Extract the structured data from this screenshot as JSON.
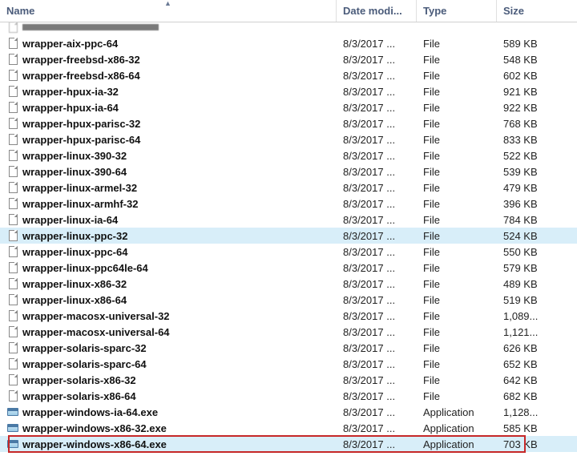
{
  "columns": {
    "name": "Name",
    "date": "Date modi...",
    "type": "Type",
    "size": "Size"
  },
  "cut_top": {
    "date": "",
    "type": "",
    "size": ""
  },
  "rows": [
    {
      "icon": "file",
      "name": "wrapper-aix-ppc-64",
      "date": "8/3/2017 ...",
      "type": "File",
      "size": "589 KB",
      "sel": false,
      "hl": false
    },
    {
      "icon": "file",
      "name": "wrapper-freebsd-x86-32",
      "date": "8/3/2017 ...",
      "type": "File",
      "size": "548 KB",
      "sel": false,
      "hl": false
    },
    {
      "icon": "file",
      "name": "wrapper-freebsd-x86-64",
      "date": "8/3/2017 ...",
      "type": "File",
      "size": "602 KB",
      "sel": false,
      "hl": false
    },
    {
      "icon": "file",
      "name": "wrapper-hpux-ia-32",
      "date": "8/3/2017 ...",
      "type": "File",
      "size": "921 KB",
      "sel": false,
      "hl": false
    },
    {
      "icon": "file",
      "name": "wrapper-hpux-ia-64",
      "date": "8/3/2017 ...",
      "type": "File",
      "size": "922 KB",
      "sel": false,
      "hl": false
    },
    {
      "icon": "file",
      "name": "wrapper-hpux-parisc-32",
      "date": "8/3/2017 ...",
      "type": "File",
      "size": "768 KB",
      "sel": false,
      "hl": false
    },
    {
      "icon": "file",
      "name": "wrapper-hpux-parisc-64",
      "date": "8/3/2017 ...",
      "type": "File",
      "size": "833 KB",
      "sel": false,
      "hl": false
    },
    {
      "icon": "file",
      "name": "wrapper-linux-390-32",
      "date": "8/3/2017 ...",
      "type": "File",
      "size": "522 KB",
      "sel": false,
      "hl": false
    },
    {
      "icon": "file",
      "name": "wrapper-linux-390-64",
      "date": "8/3/2017 ...",
      "type": "File",
      "size": "539 KB",
      "sel": false,
      "hl": false
    },
    {
      "icon": "file",
      "name": "wrapper-linux-armel-32",
      "date": "8/3/2017 ...",
      "type": "File",
      "size": "479 KB",
      "sel": false,
      "hl": false
    },
    {
      "icon": "file",
      "name": "wrapper-linux-armhf-32",
      "date": "8/3/2017 ...",
      "type": "File",
      "size": "396 KB",
      "sel": false,
      "hl": false
    },
    {
      "icon": "file",
      "name": "wrapper-linux-ia-64",
      "date": "8/3/2017 ...",
      "type": "File",
      "size": "784 KB",
      "sel": false,
      "hl": false
    },
    {
      "icon": "file",
      "name": "wrapper-linux-ppc-32",
      "date": "8/3/2017 ...",
      "type": "File",
      "size": "524 KB",
      "sel": true,
      "hl": false
    },
    {
      "icon": "file",
      "name": "wrapper-linux-ppc-64",
      "date": "8/3/2017 ...",
      "type": "File",
      "size": "550 KB",
      "sel": false,
      "hl": false
    },
    {
      "icon": "file",
      "name": "wrapper-linux-ppc64le-64",
      "date": "8/3/2017 ...",
      "type": "File",
      "size": "579 KB",
      "sel": false,
      "hl": false
    },
    {
      "icon": "file",
      "name": "wrapper-linux-x86-32",
      "date": "8/3/2017 ...",
      "type": "File",
      "size": "489 KB",
      "sel": false,
      "hl": false
    },
    {
      "icon": "file",
      "name": "wrapper-linux-x86-64",
      "date": "8/3/2017 ...",
      "type": "File",
      "size": "519 KB",
      "sel": false,
      "hl": false
    },
    {
      "icon": "file",
      "name": "wrapper-macosx-universal-32",
      "date": "8/3/2017 ...",
      "type": "File",
      "size": "1,089...",
      "sel": false,
      "hl": false
    },
    {
      "icon": "file",
      "name": "wrapper-macosx-universal-64",
      "date": "8/3/2017 ...",
      "type": "File",
      "size": "1,121...",
      "sel": false,
      "hl": false
    },
    {
      "icon": "file",
      "name": "wrapper-solaris-sparc-32",
      "date": "8/3/2017 ...",
      "type": "File",
      "size": "626 KB",
      "sel": false,
      "hl": false
    },
    {
      "icon": "file",
      "name": "wrapper-solaris-sparc-64",
      "date": "8/3/2017 ...",
      "type": "File",
      "size": "652 KB",
      "sel": false,
      "hl": false
    },
    {
      "icon": "file",
      "name": "wrapper-solaris-x86-32",
      "date": "8/3/2017 ...",
      "type": "File",
      "size": "642 KB",
      "sel": false,
      "hl": false
    },
    {
      "icon": "file",
      "name": "wrapper-solaris-x86-64",
      "date": "8/3/2017 ...",
      "type": "File",
      "size": "682 KB",
      "sel": false,
      "hl": false
    },
    {
      "icon": "exe",
      "name": "wrapper-windows-ia-64.exe",
      "date": "8/3/2017 ...",
      "type": "Application",
      "size": "1,128...",
      "sel": false,
      "hl": false
    },
    {
      "icon": "exe",
      "name": "wrapper-windows-x86-32.exe",
      "date": "8/3/2017 ...",
      "type": "Application",
      "size": "585 KB",
      "sel": false,
      "hl": false
    },
    {
      "icon": "exe",
      "name": "wrapper-windows-x86-64.exe",
      "date": "8/3/2017 ...",
      "type": "Application",
      "size": "703 KB",
      "sel": true,
      "hl": true
    }
  ]
}
